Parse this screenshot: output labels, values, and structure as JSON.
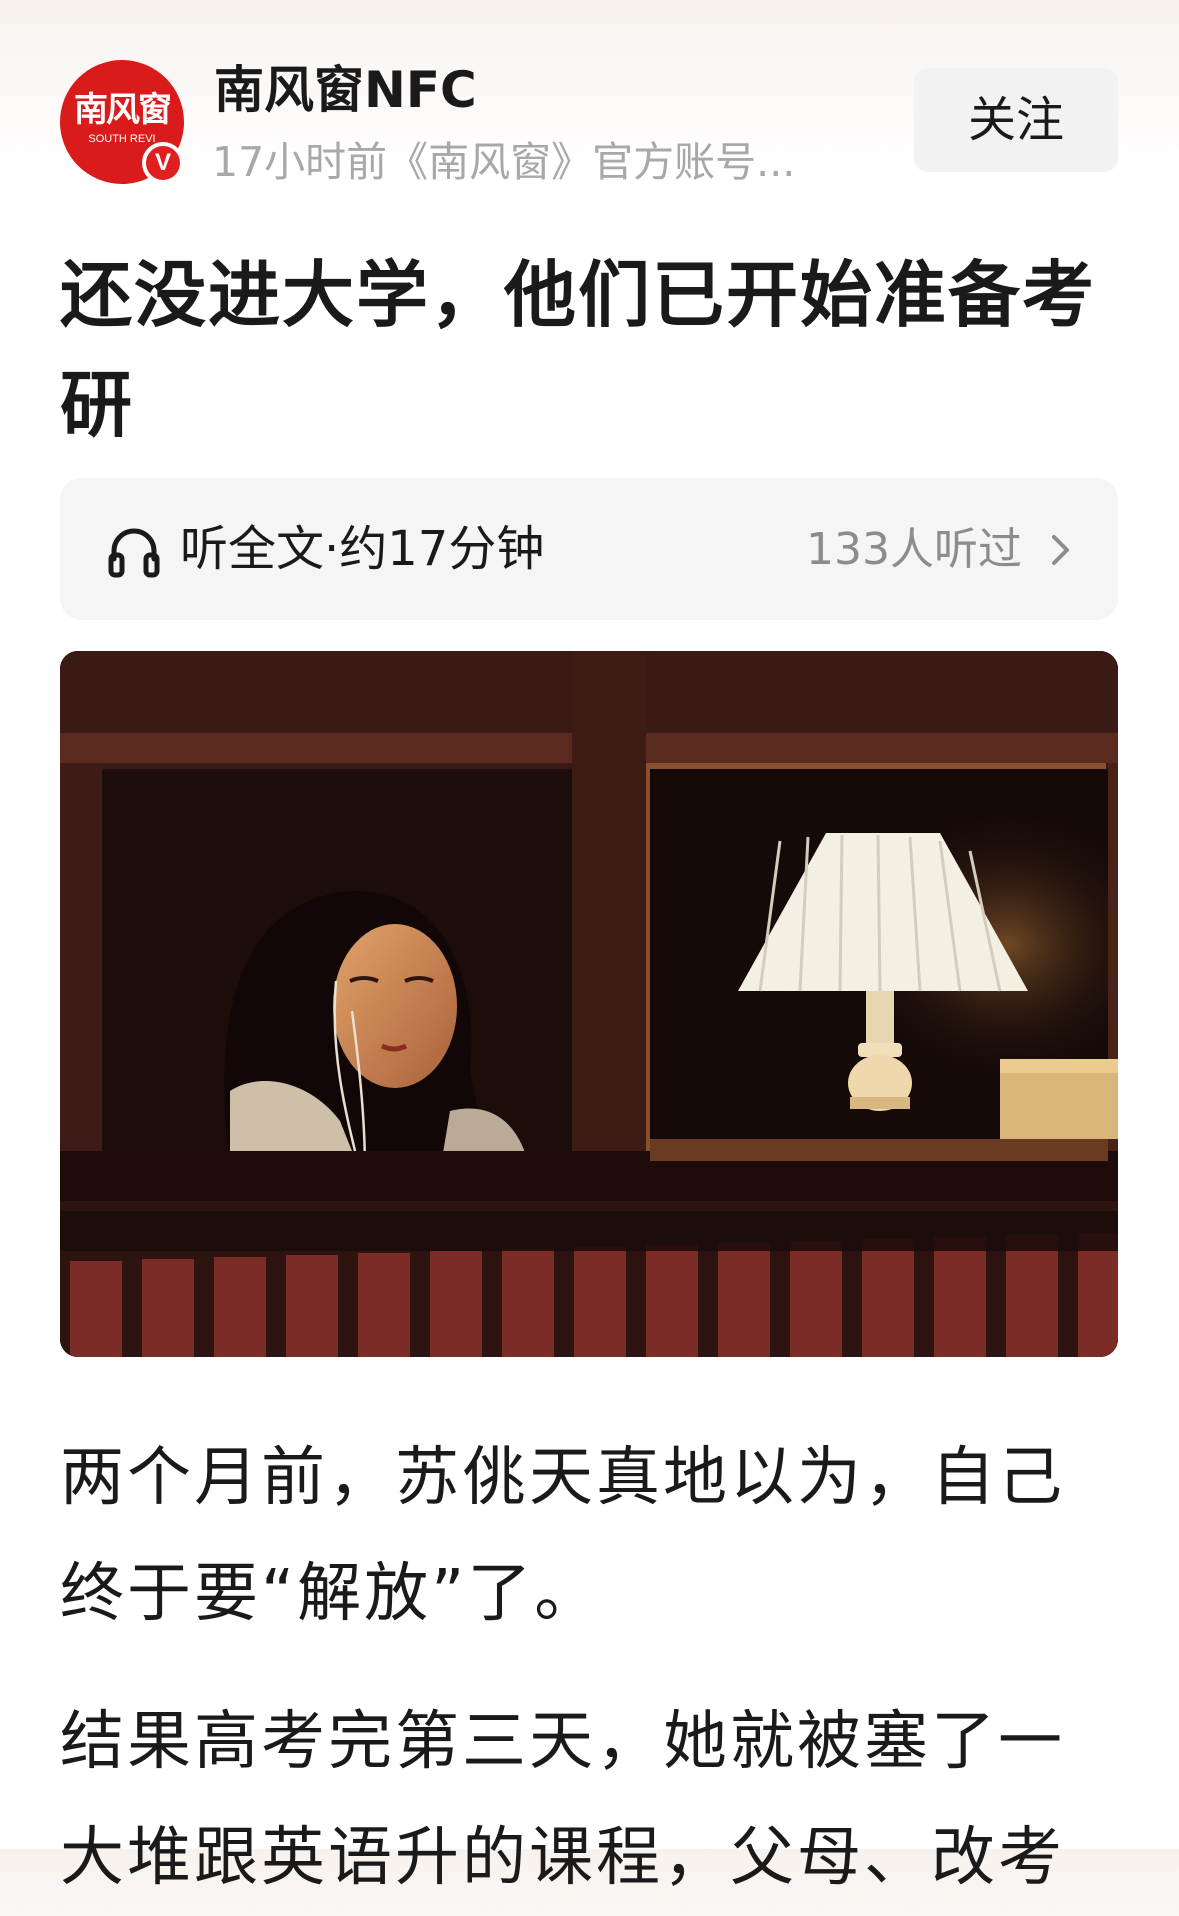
{
  "header": {
    "avatar_title": "南风窗",
    "avatar_subtitle": "SOUTH REVI",
    "verified_badge": "V",
    "account_name": "南风窗NFC",
    "meta": "17小时前《南风窗》官方账号...",
    "follow_label": "关注"
  },
  "article": {
    "title": "还没进大学，他们已开始准备考研",
    "audio": {
      "label": "听全文·约17分钟",
      "listeners": "133人听过",
      "icon": "headphone-icon"
    },
    "paragraphs": [
      "两个月前，苏佻天真地以为，自己终于要“解放”了。",
      "结果高考完第三天，她就被塞了一大堆跟英语升的课程，父母、改考"
    ]
  },
  "colors": {
    "brand_red": "#d91b1b",
    "text": "#1a1a1a",
    "meta": "#a8a8a8"
  }
}
